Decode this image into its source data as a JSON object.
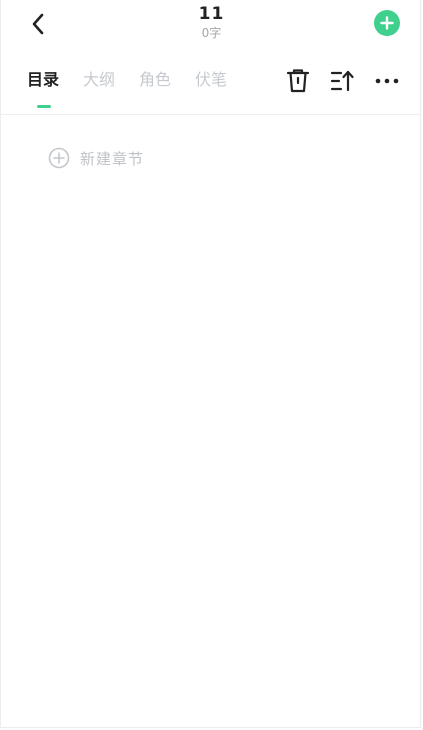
{
  "header": {
    "title": "11",
    "word_count": "0字"
  },
  "tabs": [
    {
      "label": "目录",
      "active": true
    },
    {
      "label": "大纲",
      "active": false
    },
    {
      "label": "角色",
      "active": false
    },
    {
      "label": "伏笔",
      "active": false
    }
  ],
  "content": {
    "new_chapter_label": "新建章节"
  },
  "colors": {
    "accent": "#3fd08d",
    "inactive_tab": "#c6c9cf",
    "placeholder": "#bfc2c7"
  },
  "icons": {
    "back": "chevron-left-icon",
    "add": "plus-circle-icon",
    "delete": "trash-icon",
    "sort": "sort-icon",
    "more": "more-dots-icon",
    "new_chapter": "plus-circle-outline-icon"
  }
}
